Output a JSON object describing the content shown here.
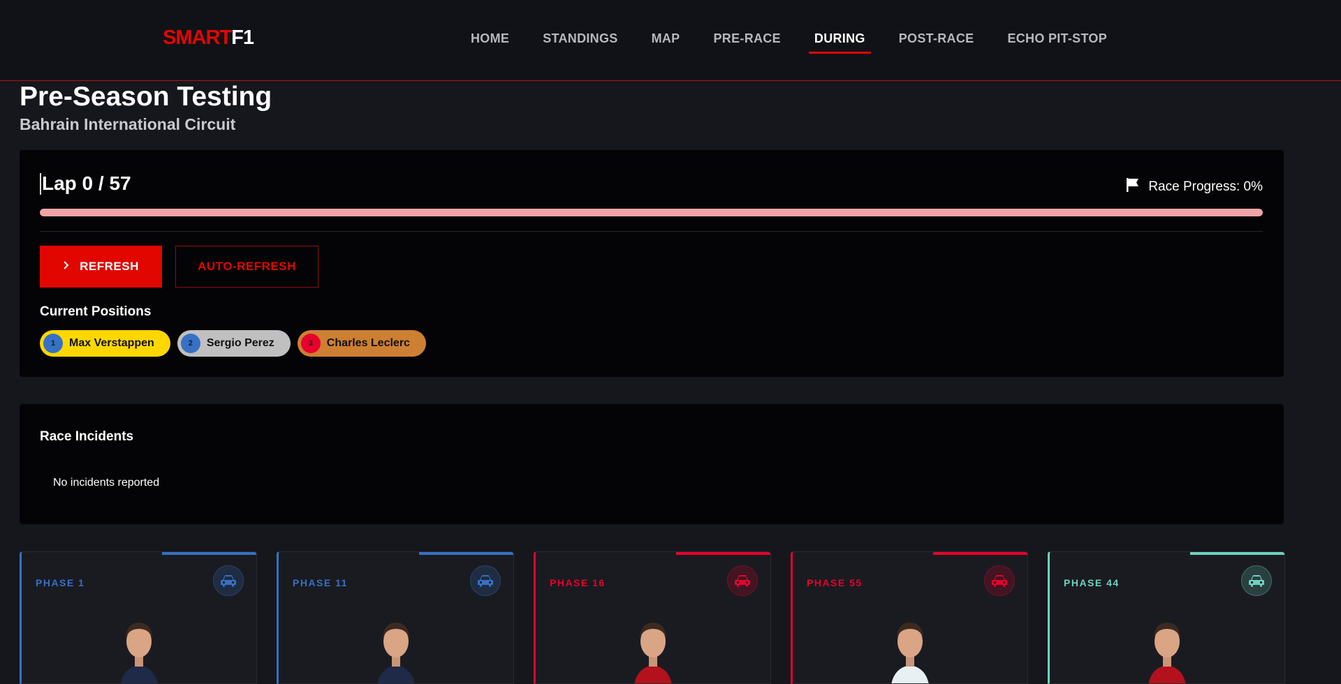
{
  "nav": {
    "logo_red": "SMART",
    "logo_white": "F1",
    "links": [
      "HOME",
      "STANDINGS",
      "MAP",
      "PRE-RACE",
      "DURING",
      "POST-RACE",
      "ECHO PIT-STOP"
    ],
    "active": "DURING"
  },
  "header": {
    "title": "Pre-Season Testing",
    "subtitle": "Bahrain International Circuit"
  },
  "race": {
    "lap_text": "Lap 0 / 57",
    "progress_text": "Race Progress: 0%",
    "progress_percent": 100,
    "refresh_label": "REFRESH",
    "auto_refresh_label": "AUTO-REFRESH",
    "positions_title": "Current Positions",
    "positions": [
      {
        "name": "Max Verstappen",
        "chip_color": "#ffd700",
        "dot_color": "#3671c6"
      },
      {
        "name": "Sergio Perez",
        "chip_color": "#c0c0c0",
        "dot_color": "#3671c6"
      },
      {
        "name": "Charles Leclerc",
        "chip_color": "#cd7f32",
        "dot_color": "#e8002d"
      }
    ]
  },
  "incidents": {
    "title": "Race Incidents",
    "empty_text": "No incidents reported"
  },
  "phases": [
    {
      "label": "PHASE 1",
      "color": "#3671c6",
      "icon": "car-icon",
      "suit": "#1e2a48"
    },
    {
      "label": "PHASE 11",
      "color": "#3671c6",
      "icon": "car-icon",
      "suit": "#1e2a48"
    },
    {
      "label": "PHASE 16",
      "color": "#e8002d",
      "icon": "car-icon",
      "suit": "#b3121c"
    },
    {
      "label": "PHASE 55",
      "color": "#e8002d",
      "icon": "car-icon",
      "suit": "#e8f0f4"
    },
    {
      "label": "PHASE 44",
      "color": "#6cd3bf",
      "icon": "car-icon",
      "suit": "#b3121c"
    }
  ]
}
